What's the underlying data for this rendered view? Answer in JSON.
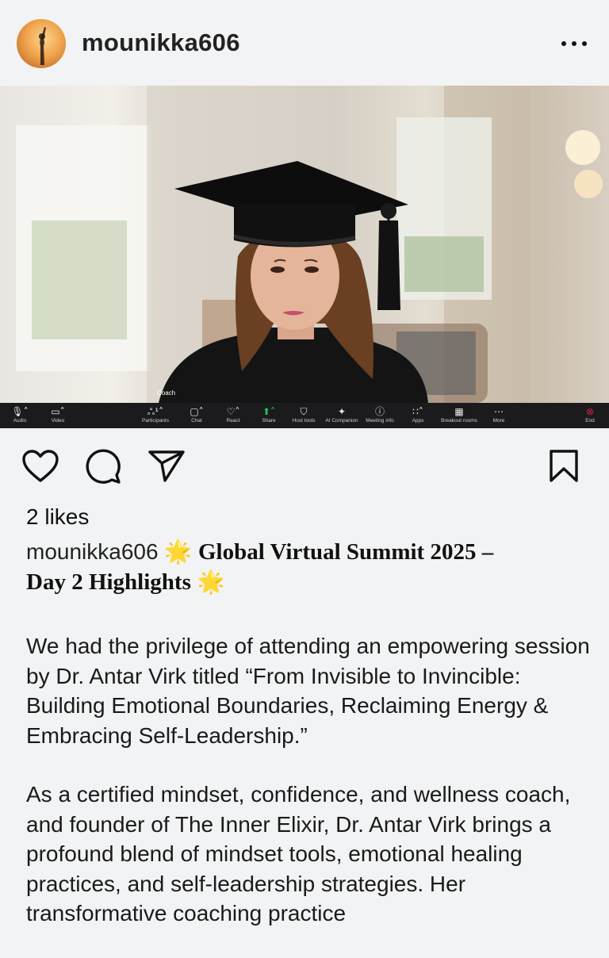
{
  "header": {
    "username": "mounikka606",
    "more_icon": "more-horizontal-icon",
    "avatar_icon": "avatar"
  },
  "photo": {
    "name_tag": "Coach",
    "toolbar": [
      {
        "label": "Audio",
        "icon": "mic-icon",
        "glyph": "🎙˄"
      },
      {
        "label": "Video",
        "icon": "video-icon",
        "glyph": "▭˄"
      },
      {
        "label": "Participants",
        "icon": "participants-icon",
        "glyph": "ஃ¹˄"
      },
      {
        "label": "Chat",
        "icon": "chat-icon",
        "glyph": "▢˄"
      },
      {
        "label": "React",
        "icon": "react-icon",
        "glyph": "♡˄"
      },
      {
        "label": "Share",
        "icon": "share-screen-icon",
        "glyph": "⬆˄"
      },
      {
        "label": "Host tools",
        "icon": "shield-icon",
        "glyph": "⛉"
      },
      {
        "label": "AI Companion",
        "icon": "sparkle-icon",
        "glyph": "✦"
      },
      {
        "label": "Meeting info",
        "icon": "info-icon",
        "glyph": "ⓘ"
      },
      {
        "label": "Apps",
        "icon": "apps-icon",
        "glyph": "∷˄"
      },
      {
        "label": "Breakout rooms",
        "icon": "breakout-icon",
        "glyph": "▦"
      },
      {
        "label": "More",
        "icon": "more-icon",
        "glyph": "⋯"
      },
      {
        "label": "End",
        "icon": "end-icon",
        "glyph": "⊗"
      }
    ],
    "accent_colors": {
      "share": "#22c55e",
      "end": "#e11d48"
    }
  },
  "actions": {
    "like_icon": "heart-icon",
    "comment_icon": "comment-icon",
    "share_icon": "send-icon",
    "save_icon": "bookmark-icon"
  },
  "post": {
    "likes": "2 likes",
    "caption_user": "mounikka606",
    "star": "🌟",
    "headline_part1": "Global Virtual Summit 2025 –",
    "headline_part2": "Day 2 Highlights",
    "paragraph1": "We had the privilege of attending an empowering session by Dr. Antar Virk titled “From Invisible to Invincible: Building Emotional Boundaries, Reclaiming Energy & Embracing Self-Leadership.”",
    "paragraph2": "As a certified mindset, confidence, and wellness coach, and founder of The Inner Elixir, Dr. Antar Virk brings a profound blend of mindset tools, emotional healing practices, and self-leadership strategies. Her transformative coaching practice"
  }
}
